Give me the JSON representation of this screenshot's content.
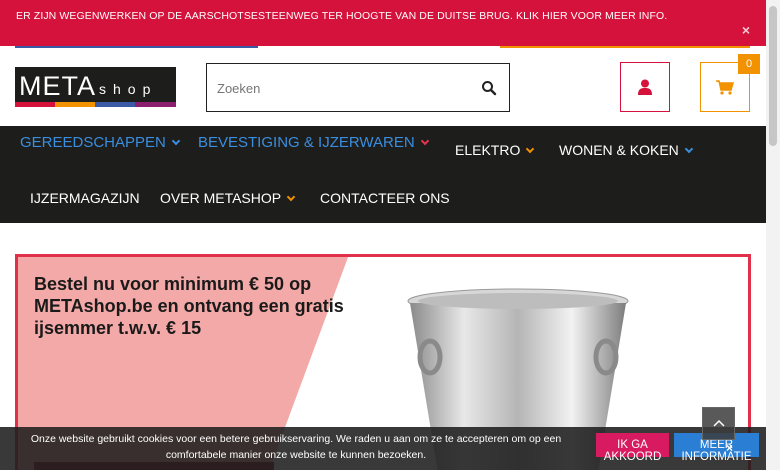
{
  "notice": {
    "text": "ER ZIJN WEGENWERKEN OP DE AARSCHOTSESTEENWEG TER HOOGTE VAN DE DUITSE BRUG. KLIK HIER VOOR MEER INFO.",
    "close": "×"
  },
  "header": {
    "logo_meta": "META",
    "logo_shop": "shop",
    "search_placeholder": "Zoeken",
    "cart_count": "0",
    "icons": [
      "search-icon",
      "user-icon",
      "cart-icon"
    ]
  },
  "nav": {
    "items": [
      {
        "label": "GEREEDSCHAPPEN"
      },
      {
        "label": "BEVESTIGING & IJZERWAREN"
      },
      {
        "label": "ELEKTRO"
      },
      {
        "label": "WONEN & KOKEN"
      },
      {
        "label": "IJZERMAGAZIJN"
      },
      {
        "label": "OVER METASHOP"
      },
      {
        "label": "CONTACTEER ONS"
      }
    ]
  },
  "banner": {
    "text": "Bestel nu voor minimum € 50 op METAshop.be en ontvang een gratis ijsemmer t.w.v. € 15"
  },
  "cookie": {
    "text": "Onze website gebruikt cookies voor een betere gebruikservaring. We raden u aan om ze te accepteren om op een comfortabele manier onze website te kunnen bezoeken.",
    "ok_line1": "IK GA",
    "ok_line2": "AKKOORD",
    "more_line1": "MEER",
    "more_line2": "INFORMATIE",
    "close": "×"
  },
  "colors": {
    "brand_red": "#d4123b",
    "brand_orange": "#f39200",
    "brand_blue": "#3a8ee0",
    "nav_bg": "#1d1d1b"
  }
}
